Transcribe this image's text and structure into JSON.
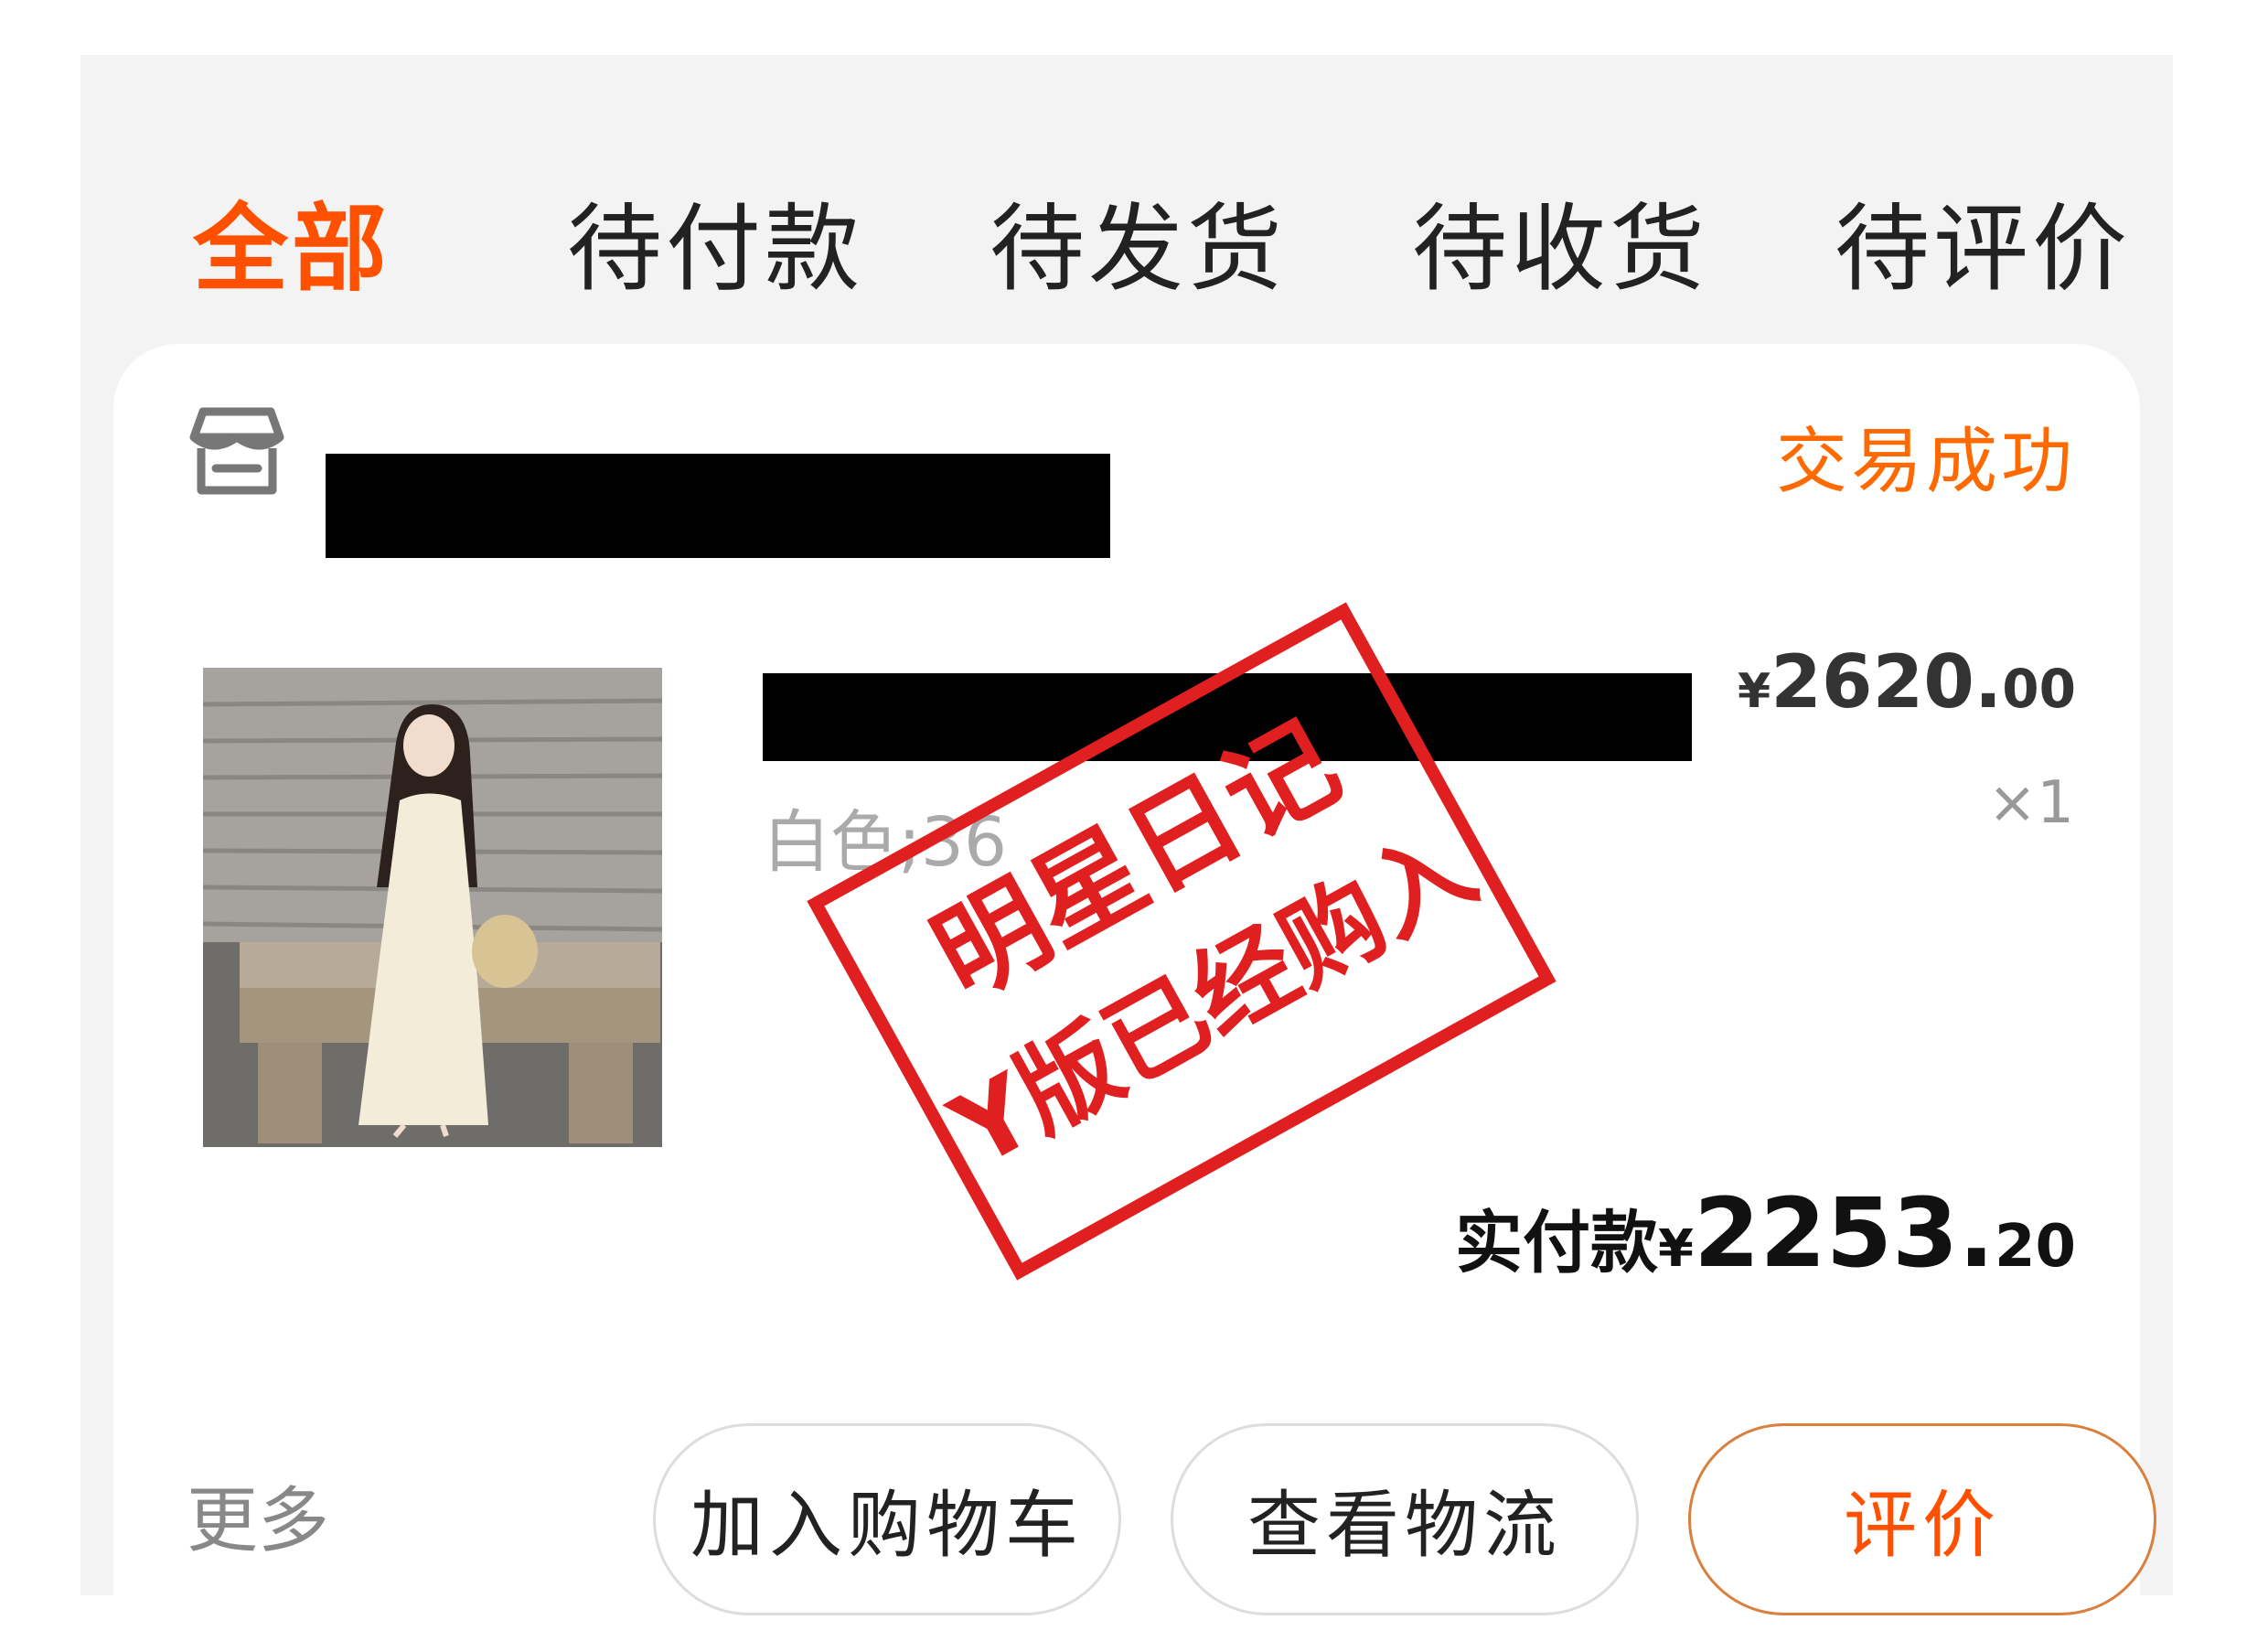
{
  "tabs": [
    {
      "label": "全部",
      "active": true
    },
    {
      "label": "待付款",
      "active": false
    },
    {
      "label": "待发货",
      "active": false
    },
    {
      "label": "待收货",
      "active": false
    },
    {
      "label": "待评价",
      "active": false
    }
  ],
  "order": {
    "store_icon": "store-icon",
    "status": "交易成功",
    "sku": "白色;36",
    "price": {
      "symbol": "¥",
      "integer": "2620.",
      "decimal": "00"
    },
    "quantity": "×1",
    "paid": {
      "label": "实付款",
      "symbol": "¥",
      "integer": "2253.",
      "decimal": "20"
    }
  },
  "stamp": {
    "line1": "明星日记",
    "line2": "Y版已经购入",
    "color": "#e02020"
  },
  "actions": {
    "more": "更多",
    "add_cart": "加入购物车",
    "logistics": "查看物流",
    "review": "评价"
  },
  "colors": {
    "accent": "#ff5000",
    "status": "#ff6a00"
  }
}
